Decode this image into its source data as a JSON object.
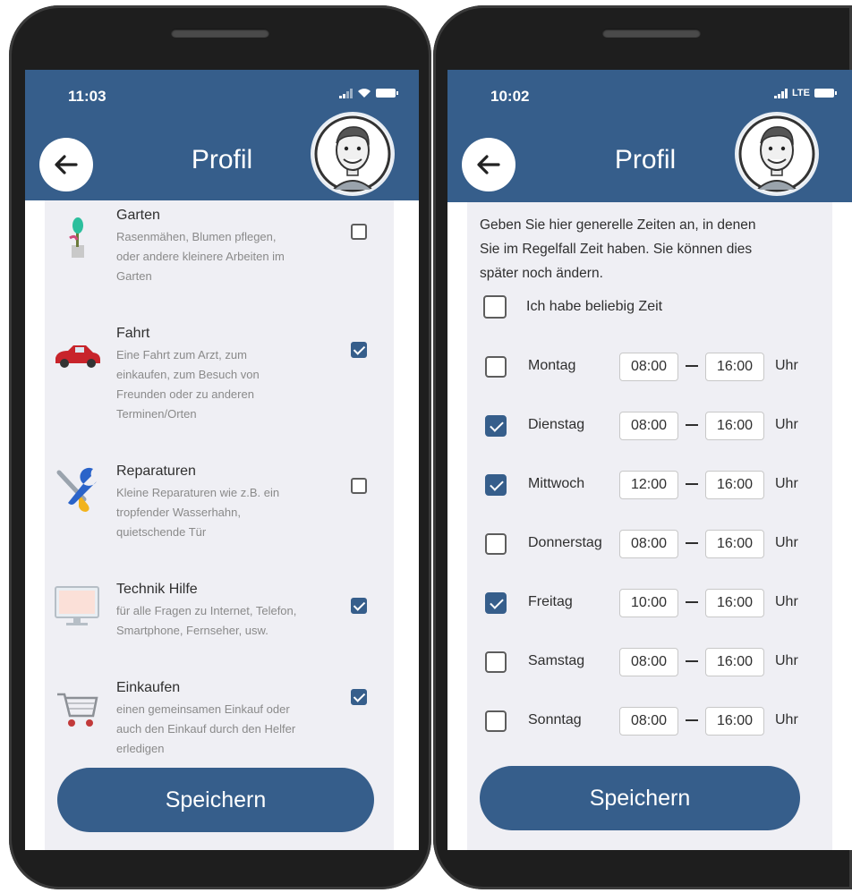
{
  "left_screen": {
    "status": {
      "time": "11:03"
    },
    "header": {
      "title": "Profil"
    },
    "services": [
      {
        "icon": "plant-icon",
        "title": "Garten",
        "desc_lines": [
          "Rasenmähen, Blumen pflegen,",
          "oder andere kleinere Arbeiten im",
          "Garten"
        ],
        "checked": false
      },
      {
        "icon": "car-icon",
        "title": "Fahrt",
        "desc_lines": [
          "Eine Fahrt zum Arzt, zum",
          "einkaufen, zum Besuch von",
          "Freunden oder zu anderen",
          "Terminen/Orten"
        ],
        "checked": true
      },
      {
        "icon": "tools-icon",
        "title": "Reparaturen",
        "desc_lines": [
          "Kleine Reparaturen wie z.B. ein",
          "tropfender Wasserhahn,",
          "quietschende Tür"
        ],
        "checked": false
      },
      {
        "icon": "monitor-icon",
        "title": "Technik Hilfe",
        "desc_lines": [
          "für alle Fragen zu Internet, Telefon,",
          "Smartphone, Fernseher, usw."
        ],
        "checked": true
      },
      {
        "icon": "cart-icon",
        "title": "Einkaufen",
        "desc_lines": [
          "einen gemeinsamen Einkauf oder",
          "auch den Einkauf durch den Helfer",
          "erledigen"
        ],
        "checked": true
      }
    ],
    "save_label": "Speichern"
  },
  "right_screen": {
    "status": {
      "time": "10:02",
      "network": "LTE"
    },
    "header": {
      "title": "Profil"
    },
    "intro_lines": [
      "Geben Sie hier generelle Zeiten an, in denen",
      "Sie im Regelfall Zeit haben. Sie können dies",
      "später noch ändern."
    ],
    "any_time_label": "Ich habe beliebig Zeit",
    "any_time_checked": false,
    "days": [
      {
        "label": "Montag",
        "from": "08:00",
        "to": "16:00",
        "unit": "Uhr",
        "checked": false
      },
      {
        "label": "Dienstag",
        "from": "08:00",
        "to": "16:00",
        "unit": "Uhr",
        "checked": true
      },
      {
        "label": "Mittwoch",
        "from": "12:00",
        "to": "16:00",
        "unit": "Uhr",
        "checked": true
      },
      {
        "label": "Donnerstag",
        "from": "08:00",
        "to": "16:00",
        "unit": "Uhr",
        "checked": false
      },
      {
        "label": "Freitag",
        "from": "10:00",
        "to": "16:00",
        "unit": "Uhr",
        "checked": true
      },
      {
        "label": "Samstag",
        "from": "08:00",
        "to": "16:00",
        "unit": "Uhr",
        "checked": false
      },
      {
        "label": "Sonntag",
        "from": "08:00",
        "to": "16:00",
        "unit": "Uhr",
        "checked": false
      }
    ],
    "save_label": "Speichern"
  },
  "colors": {
    "header": "#365e8b",
    "panel": "#efeff4",
    "button": "#365e8b"
  }
}
